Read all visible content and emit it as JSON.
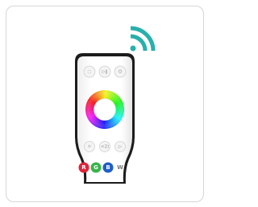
{
  "product": {
    "top_buttons": [
      "◌",
      "▷‖",
      "⏻"
    ],
    "mid_buttons": [
      "☼",
      "<2)",
      "▷"
    ],
    "color_buttons": [
      {
        "label": "R",
        "color": "#e0233a"
      },
      {
        "label": "G",
        "color": "#38b54a"
      },
      {
        "label": "B",
        "color": "#1e5fc6"
      }
    ],
    "white_button": "W",
    "signal_color": "#27b0ad",
    "remote_body_color": "#ffffff",
    "remote_outline_color": "#222222"
  }
}
